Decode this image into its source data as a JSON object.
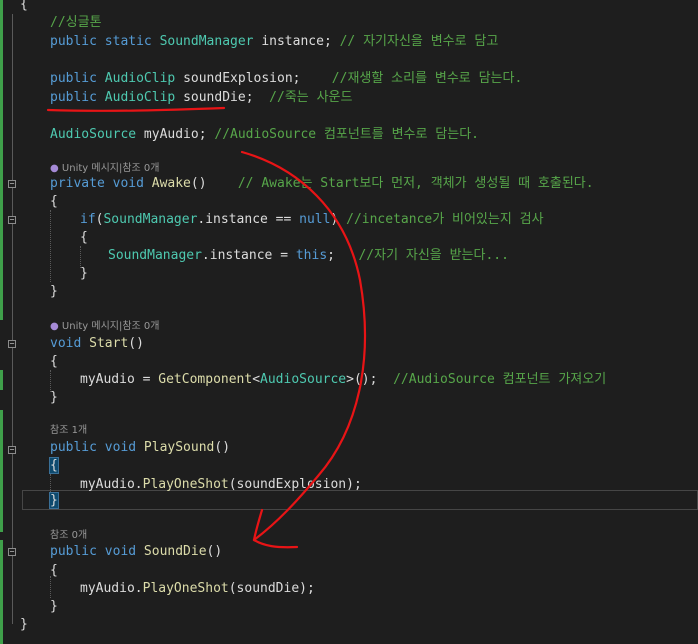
{
  "code": {
    "l0": "{",
    "l1": "//싱글톤",
    "l2": {
      "kw": "public static ",
      "ty": "SoundManager",
      "pl": " instance; ",
      "cm": "// 자기자신을 변수로 담고"
    },
    "l3": {
      "kw": "public ",
      "ty": "AudioClip",
      "pl": " soundExplosion;    ",
      "cm": "//재생할 소리를 변수로 담는다."
    },
    "l4": {
      "kw": "public ",
      "ty": "AudioClip",
      "pl": " soundDie;  ",
      "cm": "//죽는 사운드"
    },
    "l5": {
      "ty": "AudioSource",
      "pl": " myAudio; ",
      "cm": "//AudioSource 컴포넌트를 변수로 담는다."
    },
    "lens1": "Unity 메시지|참조 0개",
    "l6": {
      "kw": "private void ",
      "fn": "Awake",
      "pl": "()    ",
      "cm": "// Awake는 Start보다 먼저, 객체가 생성될 때 호출된다."
    },
    "l7": "{",
    "l8": {
      "kw": "if",
      "pl1": "(",
      "ty": "SoundManager",
      "pl2": ".instance == ",
      "kw2": "null",
      "pl3": ") ",
      "cm": "//incetance가 비어있는지 검사"
    },
    "l9": "{",
    "l10": {
      "ty": "SoundManager",
      "pl": ".instance = ",
      "kw": "this",
      "pl2": ";   ",
      "cm": "//자기 자신을 받는다..."
    },
    "l11": "}",
    "l12": "}",
    "lens2": "Unity 메시지|참조 0개",
    "l13": {
      "kw": "void ",
      "fn": "Start",
      "pl": "()"
    },
    "l14": "{",
    "l15": {
      "pl": "myAudio = ",
      "fn": "GetComponent",
      "pl2": "<",
      "ty": "AudioSource",
      "pl3": ">();  ",
      "cm": "//AudioSource 컴포넌트 가져오기"
    },
    "l16": "}",
    "lens3": "참조 1개",
    "l17": {
      "kw": "public void ",
      "fn": "PlaySound",
      "pl": "()"
    },
    "l18": "{",
    "l19": {
      "pl": "myAudio.",
      "fn": "PlayOneShot",
      "pl2": "(soundExplosion);"
    },
    "l20": "}",
    "lens4": "참조 0개",
    "l21": {
      "kw": "public void ",
      "fn": "SoundDie",
      "pl": "()"
    },
    "l22": "{",
    "l23": {
      "pl": "myAudio.",
      "fn": "PlayOneShot",
      "pl2": "(soundDie);"
    },
    "l24": "}",
    "l25": "}"
  },
  "icons": {
    "lens_icon": "unity-dot-icon",
    "fold_icon": "collapse-minus-icon"
  },
  "colors": {
    "background": "#1e1e1e",
    "keyword": "#569cd6",
    "type": "#4ec9b0",
    "method": "#dcdcaa",
    "comment": "#57a64a",
    "changed_bar": "#3fa04a",
    "annotation": "#e81416"
  }
}
